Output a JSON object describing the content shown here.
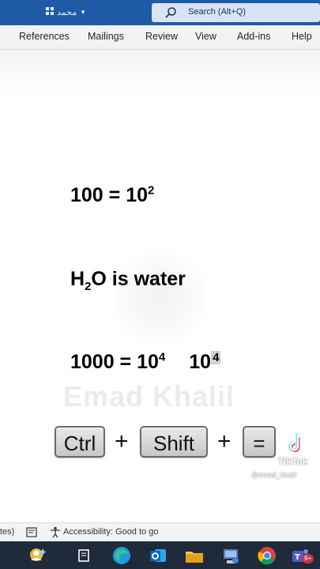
{
  "titlebar": {
    "account_name": "محمد"
  },
  "search": {
    "placeholder": "Search (Alt+Q)"
  },
  "ribbon": {
    "tabs": [
      "References",
      "Mailings",
      "Review",
      "View",
      "Add-ins",
      "Help"
    ]
  },
  "document": {
    "line1": {
      "base": "100 = 10",
      "exponent": "2"
    },
    "line2": {
      "prefix": "H",
      "subscript": "2",
      "suffix": "O is water"
    },
    "line3": {
      "base": "1000 = 10",
      "exponent": "4",
      "base2": "10",
      "exponent2": "4"
    },
    "watermark": "Emad Khalil"
  },
  "keys": {
    "ctrl": "Ctrl",
    "plus1": "+",
    "shift": "Shift",
    "plus2": "+",
    "equals": "="
  },
  "overlay": {
    "brand": "TikTok",
    "handle": "@emad_khalil"
  },
  "statusbar": {
    "left_fragment": "tes)",
    "accessibility": "Accessibility: Good to go"
  },
  "taskbar": {
    "teams_badge": "9+"
  },
  "colors": {
    "titlebar": "#1f5aa6",
    "ribbon": "#f3f3f3",
    "taskbar": "#1f2a3a"
  }
}
